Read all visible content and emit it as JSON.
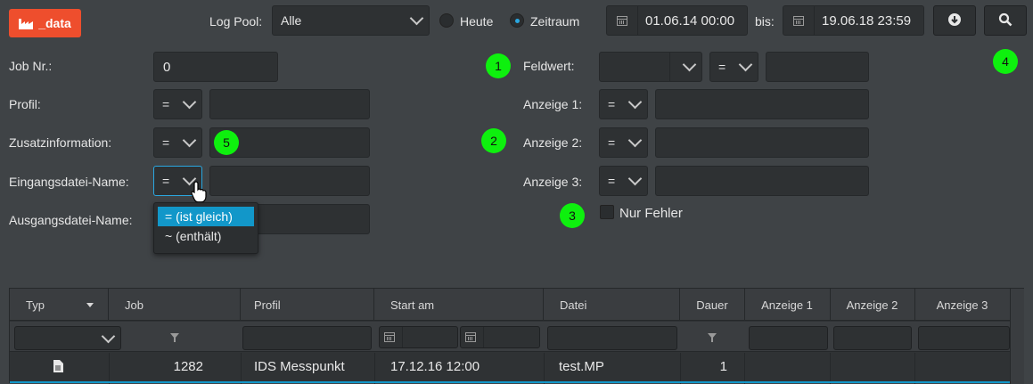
{
  "logo": {
    "label": "_data",
    "color": "#ee4e2d"
  },
  "toolbar": {
    "log_pool_label": "Log Pool:",
    "log_pool_value": "Alle",
    "radio_today": "Heute",
    "radio_range": "Zeitraum",
    "radio_selected": "Zeitraum",
    "date_from": "01.06.14 00:00",
    "bis_label": "bis:",
    "date_to": "19.06.18 23:59",
    "download_icon": "download-icon",
    "search_icon": "search-icon"
  },
  "annotations": [
    "1",
    "2",
    "3",
    "4",
    "5"
  ],
  "left_form": {
    "job_nr_label": "Job Nr.:",
    "job_nr_value": "0",
    "profil_label": "Profil:",
    "zusatz_label": "Zusatzinformation:",
    "eingang_label": "Eingangsdatei-Name:",
    "ausgang_label": "Ausgangsdatei-Name:",
    "op_value": "="
  },
  "operator_dropdown": {
    "options": [
      "= (ist gleich)",
      "~ (enthält)"
    ],
    "selected": "= (ist gleich)"
  },
  "right_form": {
    "feldwert_label": "Feldwert:",
    "feldwert_op": "=",
    "anzeige1_label": "Anzeige 1:",
    "anzeige2_label": "Anzeige 2:",
    "anzeige3_label": "Anzeige 3:",
    "op_value": "=",
    "nur_fehler_label": "Nur Fehler"
  },
  "grid": {
    "columns": [
      "Typ",
      "Job",
      "Profil",
      "Start am",
      "Datei",
      "Dauer",
      "Anzeige 1",
      "Anzeige 2",
      "Anzeige 3"
    ],
    "rows": [
      {
        "typ_icon": "document-icon",
        "job": "1282",
        "profil": "IDS Messpunkt",
        "start": "17.12.16 12:00",
        "datei": "test.MP",
        "dauer": "1",
        "anzeige1": "",
        "anzeige2": "",
        "anzeige3": ""
      }
    ]
  }
}
